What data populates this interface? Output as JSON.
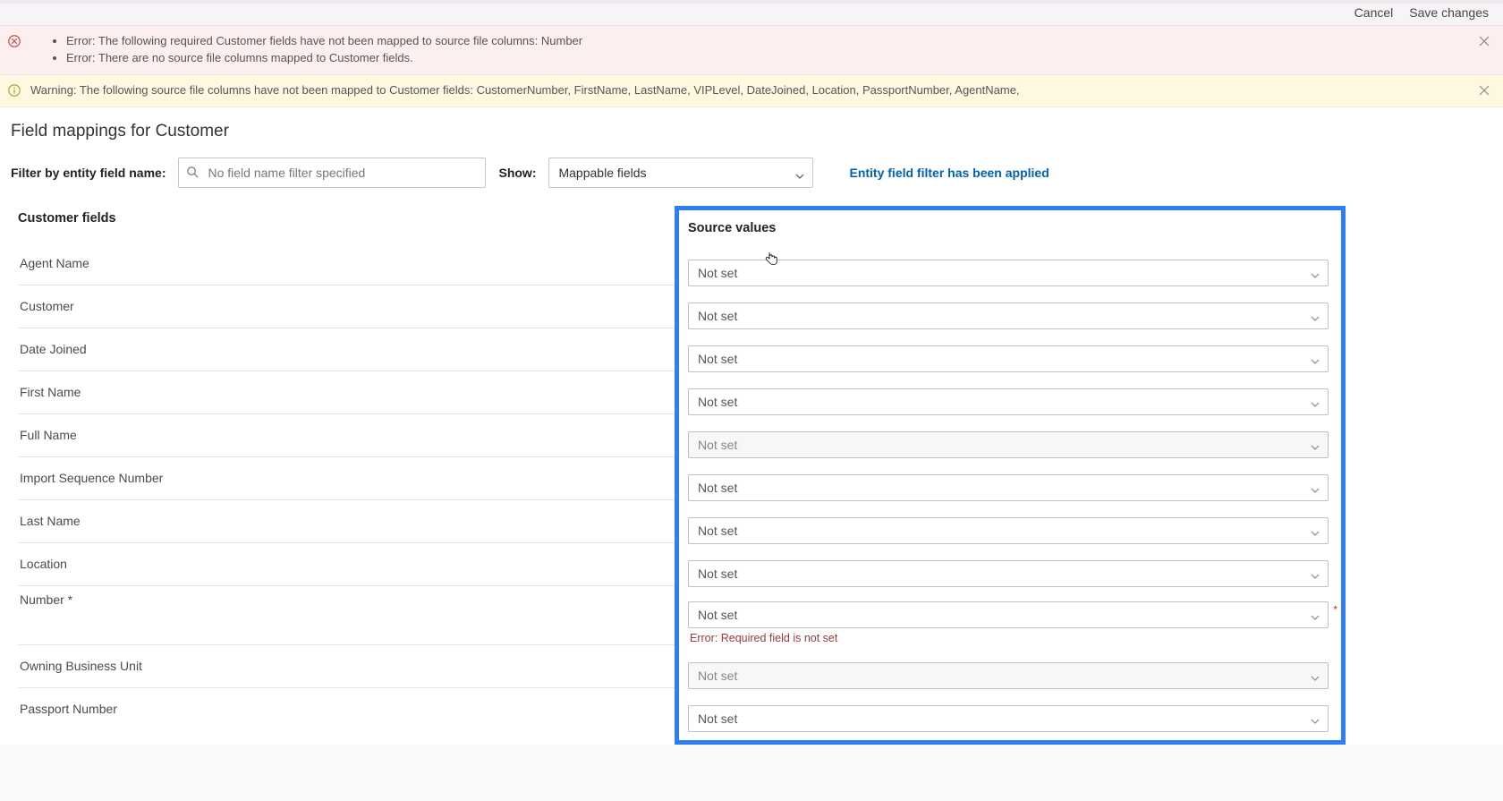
{
  "header": {
    "cancel": "Cancel",
    "save": "Save changes"
  },
  "alerts": {
    "error_items": [
      "Error: The following required Customer fields have not been mapped to source file columns: Number",
      "Error: There are no source file columns mapped to Customer fields."
    ],
    "warning": "Warning: The following source file columns have not been mapped to Customer fields: CustomerNumber, FirstName, LastName, VIPLevel, DateJoined, Location, PassportNumber, AgentName,"
  },
  "page_title": "Field mappings for Customer",
  "controls": {
    "filter_label": "Filter by entity field name:",
    "filter_placeholder": "No field name filter specified",
    "show_label": "Show:",
    "show_value": "Mappable fields",
    "filter_applied_msg": "Entity field filter has been applied"
  },
  "columns": {
    "left_header": "Customer fields",
    "right_header": "Source values"
  },
  "not_set": "Not set",
  "fields": [
    {
      "label": "Agent Name",
      "value_key": "not_set",
      "disabled": false
    },
    {
      "label": "Customer",
      "value_key": "not_set",
      "disabled": false
    },
    {
      "label": "Date Joined",
      "value_key": "not_set",
      "disabled": false
    },
    {
      "label": "First Name",
      "value_key": "not_set",
      "disabled": false
    },
    {
      "label": "Full Name",
      "value_key": "not_set",
      "disabled": true
    },
    {
      "label": "Import Sequence Number",
      "value_key": "not_set",
      "disabled": false
    },
    {
      "label": "Last Name",
      "value_key": "not_set",
      "disabled": false
    },
    {
      "label": "Location",
      "value_key": "not_set",
      "disabled": false
    },
    {
      "label": "Number *",
      "value_key": "not_set",
      "disabled": false,
      "required": true,
      "error": "Error: Required field is not set"
    },
    {
      "label": "Owning Business Unit",
      "value_key": "not_set",
      "disabled": true
    },
    {
      "label": "Passport Number",
      "value_key": "not_set",
      "disabled": false
    }
  ]
}
